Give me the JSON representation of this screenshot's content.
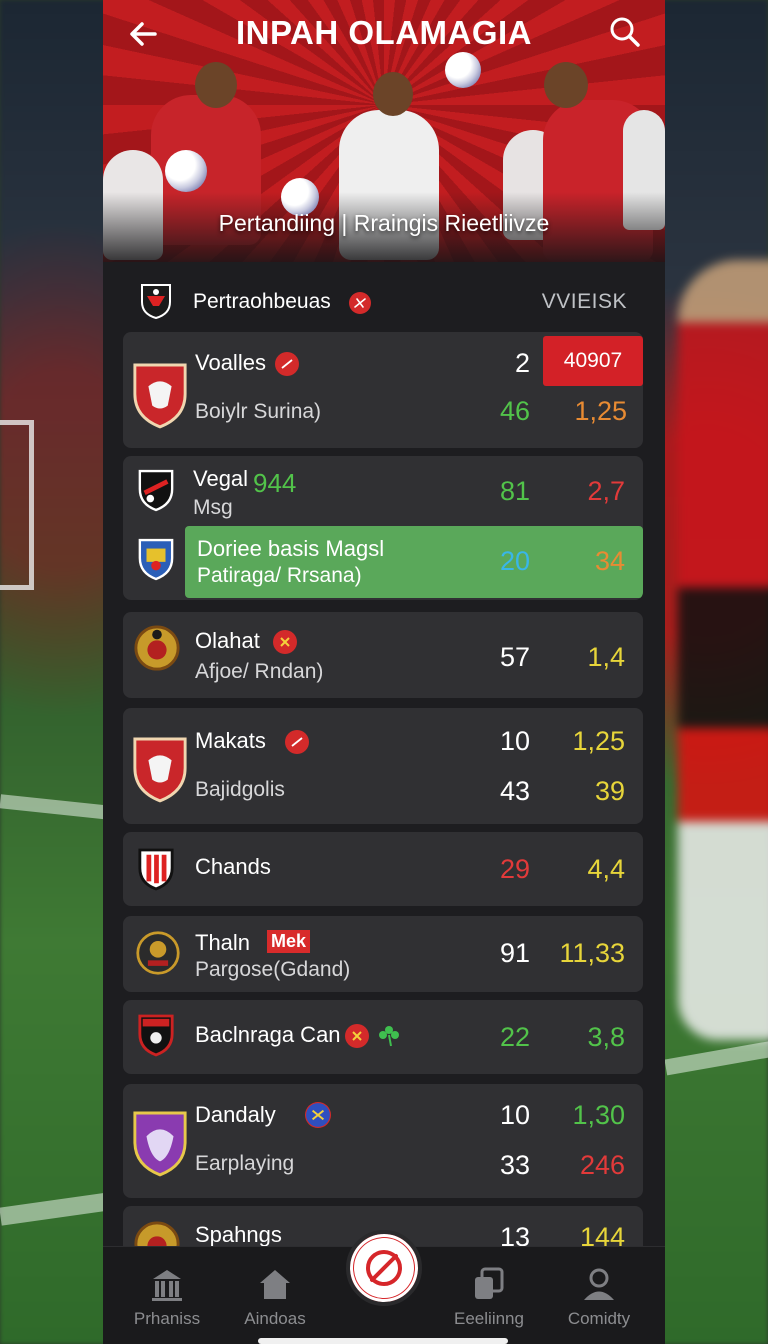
{
  "header": {
    "title": "INPAH OLAMAGIA",
    "subtitle": "Pertandiing | Rraingis Rieetliivze"
  },
  "section": {
    "title": "Pertraohbeuas",
    "week_label": "VVIEISK"
  },
  "matches": [
    {
      "team": "Voalles",
      "detail": "Boiylr Surina)",
      "values_top": [
        "2",
        "40907"
      ],
      "values_bottom": [
        "46",
        "1,25"
      ]
    },
    {
      "team": "Vegal",
      "team_badge": "944",
      "detail": "Msg",
      "values": [
        "81",
        "2,7"
      ]
    },
    {
      "team": "Doriee basis Magsl",
      "detail": "Patiraga/ Rrsana)",
      "values": [
        "20",
        "34"
      ]
    },
    {
      "team": "Olahat",
      "detail": "Afjoe/ Rndan)",
      "values": [
        "57",
        "1,4"
      ]
    },
    {
      "team": "Makats",
      "detail": "Bajidgolis",
      "values_top": [
        "10",
        "1,25"
      ],
      "values_bottom": [
        "43",
        "39"
      ]
    },
    {
      "team": "Chands",
      "values": [
        "29",
        "4,4"
      ]
    },
    {
      "team": "Thaln",
      "team_badge": "Mek",
      "detail": "Pargose(Gdand)",
      "values": [
        "91",
        "11,33"
      ]
    },
    {
      "team": "Baclnraga Can",
      "values": [
        "22",
        "3,8"
      ]
    },
    {
      "team": "Dandaly",
      "detail": "Earplaying",
      "values_top": [
        "10",
        "1,30"
      ],
      "values_bottom": [
        "33",
        "246"
      ]
    },
    {
      "team": "Spahngs",
      "values": [
        "13",
        "144"
      ]
    }
  ],
  "nav": [
    {
      "label": "Prhaniss",
      "icon": "stadium-icon"
    },
    {
      "label": "Aindoas",
      "icon": "home-icon"
    },
    {
      "label": "Eeeliinng",
      "icon": "screens-icon"
    },
    {
      "label": "Comidty",
      "icon": "user-icon"
    }
  ],
  "colors": {
    "accent_red": "#d32127",
    "highlight_green": "#5aa85a",
    "value_green": "#52c34a",
    "value_yellow": "#e7d53a",
    "value_red": "#e23a3a"
  }
}
